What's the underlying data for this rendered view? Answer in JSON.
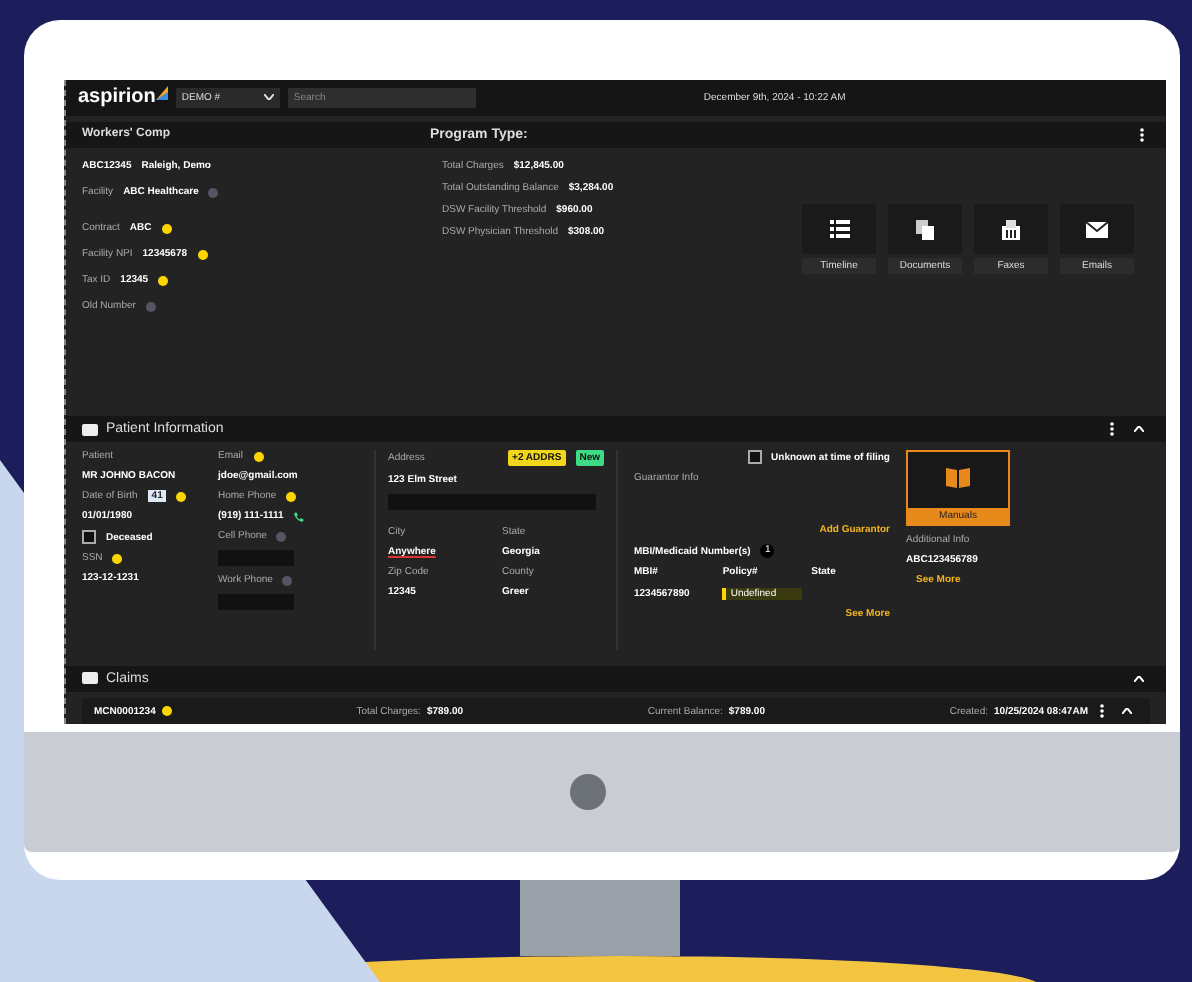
{
  "header": {
    "logo": "aspirion",
    "dropdown": "DEMO #",
    "search": {
      "placeholder": "Search"
    },
    "datetime": "December 9th, 2024 - 10:22 AM"
  },
  "account": {
    "title": "Workers' Comp",
    "id": "ABC12345",
    "location": "Raleigh, Demo",
    "fields": [
      {
        "label": "Facility",
        "value": "ABC Healthcare",
        "flag": false
      },
      {
        "label": "Contract",
        "value": "ABC",
        "flag": true
      },
      {
        "label": "Facility NPI",
        "value": "12345678",
        "flag": true
      },
      {
        "label": "Tax ID",
        "value": "12345",
        "flag": true
      },
      {
        "label": "Old Number",
        "flag": false
      }
    ]
  },
  "program": {
    "title": "Program Type:",
    "rows": [
      {
        "label": "Total Charges",
        "value": "$12,845.00"
      },
      {
        "label": "Total Outstanding Balance",
        "value": "$3,284.00"
      },
      {
        "label": "DSW Facility Threshold",
        "value": "$960.00"
      },
      {
        "label": "DSW Physician Threshold",
        "value": "$308.00"
      }
    ]
  },
  "tiles": [
    {
      "kind": "list",
      "label": "Timeline"
    },
    {
      "kind": "docs",
      "label": "Documents"
    },
    {
      "kind": "fax",
      "label": "Faxes"
    },
    {
      "kind": "mail",
      "label": "Emails"
    }
  ],
  "patient": {
    "title": "Patient Information",
    "name_label": "Patient",
    "name": "MR JOHNO BACON",
    "dob_label": "Date of Birth",
    "age": "41",
    "dob": "01/01/1980",
    "deceased": {
      "label": "Deceased",
      "checked": false
    },
    "ssn_label": "SSN",
    "ssn": "123-12-1231",
    "email_label": "Email",
    "email": "jdoe@gmail.com",
    "home_label": "Home Phone",
    "home": "(919) 111-1111",
    "cell_label": "Cell Phone",
    "work_label": "Work Phone",
    "address_label": "Address",
    "address": "123 Elm Street",
    "tags": [
      {
        "text": "+2 ADDRS",
        "color": "#f2d61b"
      },
      {
        "text": "New",
        "color": "#3ddc84"
      }
    ],
    "city_label": "City",
    "city": "Anywhere",
    "state_label": "State",
    "state": "Georgia",
    "zip_label": "Zip Code",
    "zip": "12345",
    "county_label": "County",
    "county": "Greer",
    "guarantor_label": "Guarantor Info",
    "unknown": {
      "label": "Unknown at time of filing",
      "checked": false
    },
    "add_guarantor": "Add Guarantor",
    "mbi_label": "MBI/Medicaid Number(s)",
    "mbi_count": "1",
    "mbi_cols": [
      "MBI#",
      "Policy#",
      "State"
    ],
    "mbi_row": [
      "1234567890",
      "Undefined"
    ],
    "see_more_1": "See More",
    "additional_label": "Additional Info",
    "additional": "ABC123456789",
    "see_more_2": "See More",
    "manuals": "Manuals"
  },
  "claims": {
    "title": "Claims",
    "row": {
      "id": "MCN0001234",
      "charges_label": "Total Charges:",
      "charges": "$789.00",
      "balance_label": "Current Balance:",
      "balance": "$789.00",
      "created_label": "Created:",
      "created": "10/25/2024 08:47AM"
    }
  }
}
